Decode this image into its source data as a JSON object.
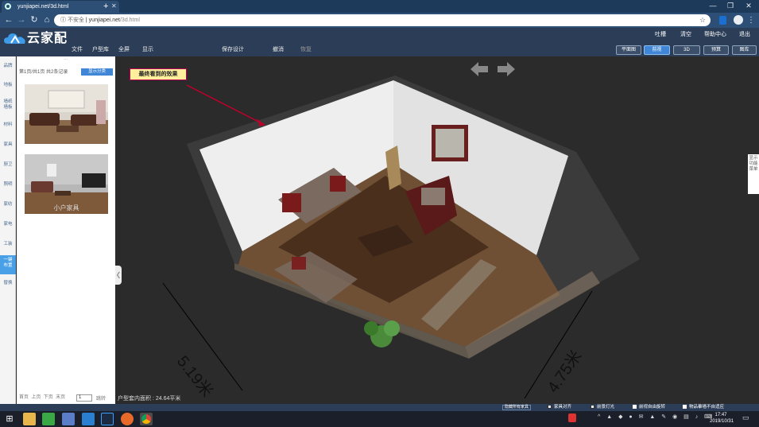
{
  "browser": {
    "tab_title": "yunjiapei.net/3d.html",
    "new_tab": "+",
    "security": "不安全",
    "host": "yunjiapei.net",
    "path": "/3d.html",
    "window_buttons": [
      "—",
      "❐",
      "✕"
    ]
  },
  "app": {
    "logo": "云家配",
    "top_links": [
      "吐槽",
      "清空",
      "帮助中心",
      "退出"
    ],
    "menu": [
      "文件",
      "户型库",
      "全屏",
      "显示",
      "保存设计",
      "撤消",
      "恢复"
    ],
    "view_tabs": [
      "平面图",
      "前视",
      "3D",
      "预算",
      "图库"
    ],
    "active_view": "前视"
  },
  "left_nav": [
    "品牌",
    "地板",
    "墙纸墙板",
    "材料",
    "家具",
    "厨卫",
    "照明",
    "家纺",
    "家电",
    "工装",
    "一键布置",
    "替换"
  ],
  "panel": {
    "page_info": "第1页/共1页 共2条记录",
    "show_category": "显示分类",
    "dots": "∙∙∙",
    "thumb_caption": "小户家具",
    "pager": {
      "first": "首页",
      "prev": "上页",
      "next": "下页",
      "last": "末页",
      "page": "1",
      "go": "跳转"
    }
  },
  "viewport": {
    "area_text": "户型套内面积 : 24.64平米",
    "annotation": "最终看到的效果",
    "dim_left": "5.19米",
    "dim_right": "4.75米",
    "side_tab": "显示功能菜单"
  },
  "bottom_options": {
    "hide_all": "隐藏所有家具",
    "items": [
      {
        "label": "家具对齐",
        "checked": true
      },
      {
        "label": "前景灯光",
        "checked": true
      },
      {
        "label": "前视自由旋转",
        "checked": false
      },
      {
        "label": "物品摹墙不自适应",
        "checked": false
      }
    ]
  },
  "taskbar": {
    "time": "17:47",
    "date": "2019/10/31"
  },
  "colors": {
    "accent": "#3f86d6",
    "app_bar": "#2c3d57",
    "browser_bar": "#2d4f75"
  }
}
